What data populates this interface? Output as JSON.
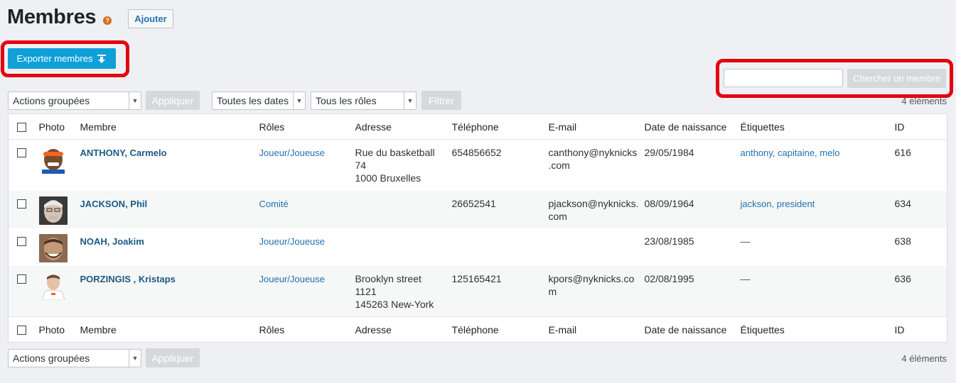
{
  "page": {
    "title": "Membres",
    "help": "?",
    "add_label": "Ajouter"
  },
  "toolbar": {
    "export_label": "Exporter membres",
    "search_value": "",
    "search_button": "Chercher un membre",
    "bulk_actions": "Actions groupées",
    "apply_label": "Appliquer",
    "dates_filter": "Toutes les dates",
    "roles_filter": "Tous les rôles",
    "filter_label": "Filtrer",
    "count": "4 éléments"
  },
  "table": {
    "columns": {
      "photo": "Photo",
      "member": "Membre",
      "roles": "Rôles",
      "address": "Adresse",
      "phone": "Téléphone",
      "email": "E-mail",
      "birth": "Date de naissance",
      "tags": "Étiquettes",
      "id": "ID"
    },
    "rows": [
      {
        "name": "ANTHONY, Carmelo",
        "role": "Joueur/Joueuse",
        "address": [
          "Rue du basketball",
          "74",
          "1000 Bruxelles"
        ],
        "phone": "654856652",
        "email": [
          "canthony@nyknicks",
          ".com"
        ],
        "birth": "29/05/1984",
        "tags": "anthony, capitaine, melo",
        "id": "616"
      },
      {
        "name": "JACKSON, Phil",
        "role": "Comité",
        "address": [
          "",
          "",
          ""
        ],
        "phone": "26652541",
        "email": [
          "pjackson@nyknicks.",
          "com"
        ],
        "birth": "08/09/1964",
        "tags": "jackson, president",
        "id": "634"
      },
      {
        "name": "NOAH, Joakim",
        "role": "Joueur/Joueuse",
        "address": [
          "",
          "",
          ""
        ],
        "phone": "",
        "email": [
          "",
          ""
        ],
        "birth": "23/08/1985",
        "tags": "—",
        "id": "638"
      },
      {
        "name": "PORZINGIS , Kristaps",
        "role": "Joueur/Joueuse",
        "address": [
          "Brooklyn street",
          "1121",
          "145263 New-York"
        ],
        "phone": "125165421",
        "email": [
          "kpors@nyknicks.co",
          "m"
        ],
        "birth": "02/08/1995",
        "tags": "—",
        "id": "636"
      }
    ]
  },
  "icons": {
    "export": "download-arrow-icon",
    "help": "question-circle-icon"
  },
  "colors": {
    "accent": "#0fa0d8",
    "highlight": "#e3000f",
    "link": "#2271b1",
    "help": "#d56b1f"
  }
}
